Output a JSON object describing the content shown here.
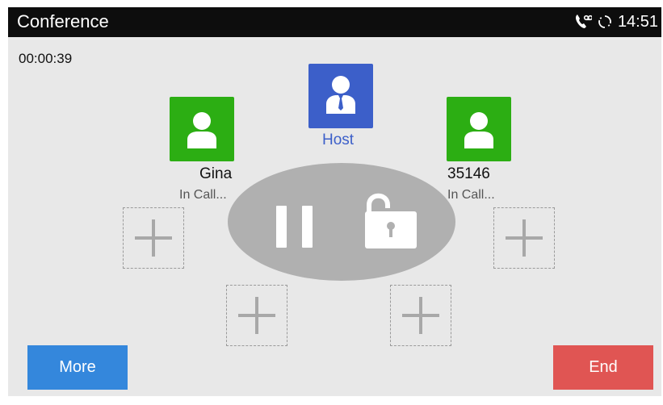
{
  "header": {
    "title": "Conference",
    "time": "14:51",
    "icons": [
      "phone-voicemail-icon",
      "sync-icon"
    ]
  },
  "call": {
    "duration": "00:00:39"
  },
  "participants": [
    {
      "role": "host",
      "label": "Host",
      "color": "#3c5fc9",
      "icon": "person-tie-icon"
    },
    {
      "name": "Gina",
      "status": "In Call...",
      "color": "#2cae13",
      "icon": "person-icon"
    },
    {
      "name": "35146",
      "status": "In Call...",
      "color": "#2cae13",
      "icon": "person-icon"
    }
  ],
  "controls": {
    "pause_icon": "pause-icon",
    "lock_icon": "unlocked-padlock-icon"
  },
  "empty_slots": {
    "count": 4,
    "icon": "add-icon"
  },
  "buttons": {
    "more_label": "More",
    "end_label": "End",
    "more_color": "#3487dc",
    "end_color": "#e05553"
  }
}
